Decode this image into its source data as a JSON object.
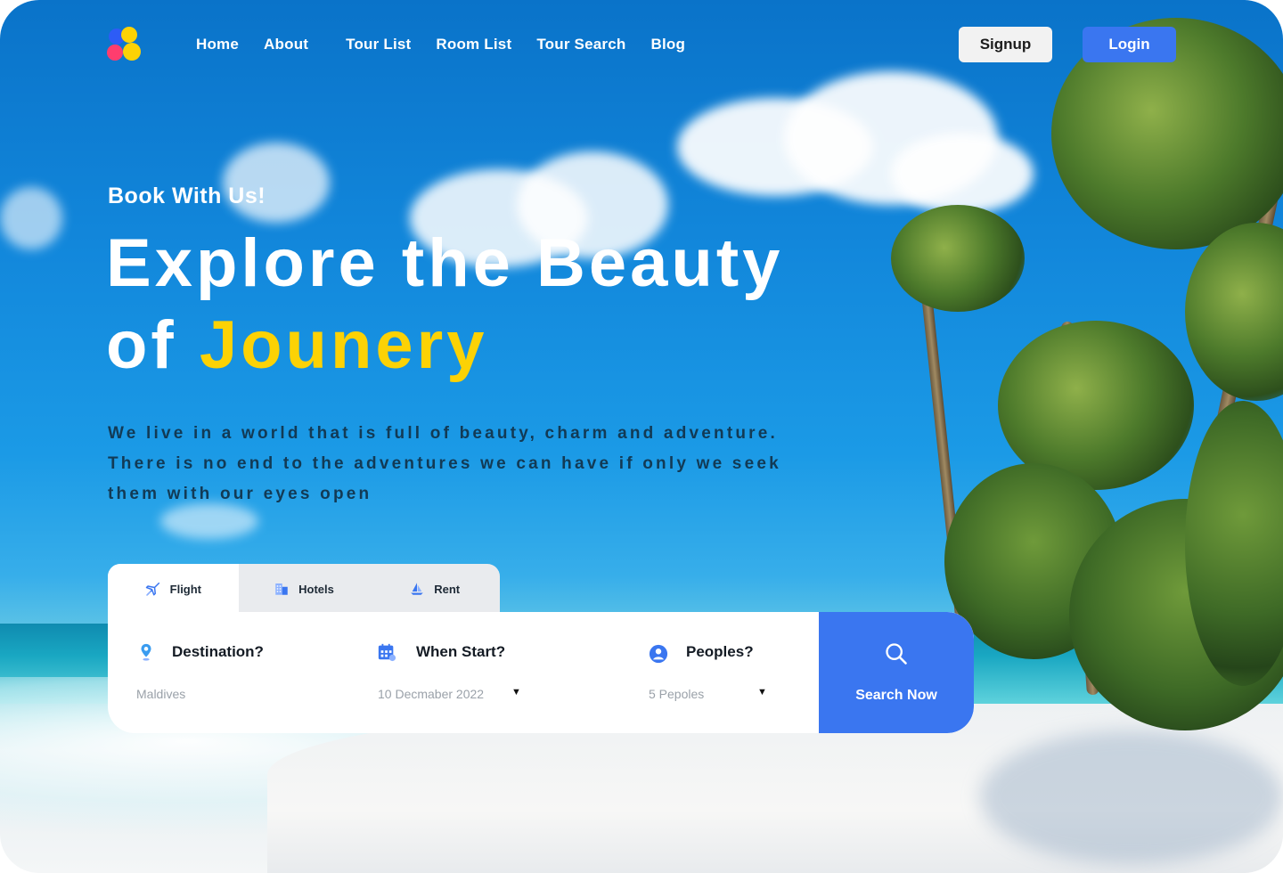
{
  "nav": {
    "links": [
      "Home",
      "About",
      "Tour List",
      "Room List",
      "Tour Search",
      "Blog"
    ],
    "signup_label": "Signup",
    "login_label": "Login"
  },
  "hero": {
    "tagline": "Book With Us!",
    "headline_line1": "Explore the Beauty",
    "headline_line2_prefix": "of",
    "headline_accent": "Jounery",
    "description": "We live in a world that is full of beauty, charm and adventure. There is no end to the adventures we can have if only we seek them with our eyes open"
  },
  "booking": {
    "tabs": [
      {
        "label": "Flight",
        "icon": "plane-icon",
        "active": true
      },
      {
        "label": "Hotels",
        "icon": "hotel-icon",
        "active": false
      },
      {
        "label": "Rent",
        "icon": "boat-icon",
        "active": false
      }
    ],
    "fields": [
      {
        "label": "Destination?",
        "value": "Maldives",
        "icon": "location-pin-icon"
      },
      {
        "label": "When Start?",
        "value": "10 Decmaber 2022",
        "icon": "calendar-icon"
      },
      {
        "label": "Peoples?",
        "value": "5 Pepoles",
        "icon": "user-icon"
      }
    ],
    "search_label": "Search Now"
  },
  "colors": {
    "accent_yellow": "#fcd205",
    "primary_blue": "#3a76f0",
    "signup_bg": "#f2f2f2"
  }
}
